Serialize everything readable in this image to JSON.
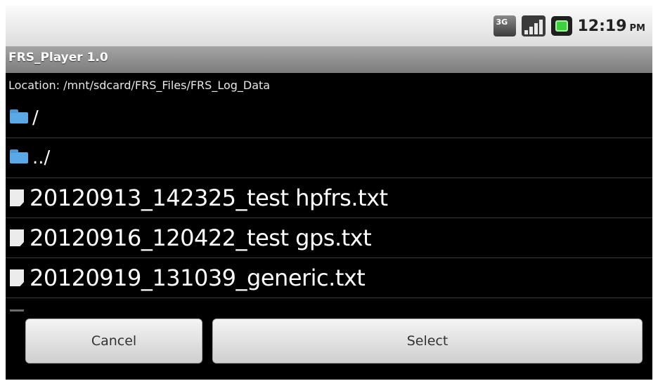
{
  "status_bar": {
    "network_label": "3G",
    "icons": [
      "network-3g-icon",
      "signal-strength-icon",
      "battery-icon"
    ],
    "time": "12:19",
    "ampm": "PM"
  },
  "app": {
    "title": "FRS_Player 1.0"
  },
  "location": "Location: /mnt/sdcard/FRS_Files/FRS_Log_Data",
  "entries": [
    {
      "type": "folder",
      "name": "/"
    },
    {
      "type": "folder",
      "name": "../"
    },
    {
      "type": "file",
      "name": "20120913_142325_test hpfrs.txt"
    },
    {
      "type": "file",
      "name": "20120916_120422_test gps.txt"
    },
    {
      "type": "file",
      "name": "20120919_131039_generic.txt"
    }
  ],
  "buttons": {
    "cancel": "Cancel",
    "select": "Select"
  },
  "colors": {
    "background": "#000000",
    "title_bar": "#8c8c8c",
    "folder_icon": "#5aa9e6"
  }
}
